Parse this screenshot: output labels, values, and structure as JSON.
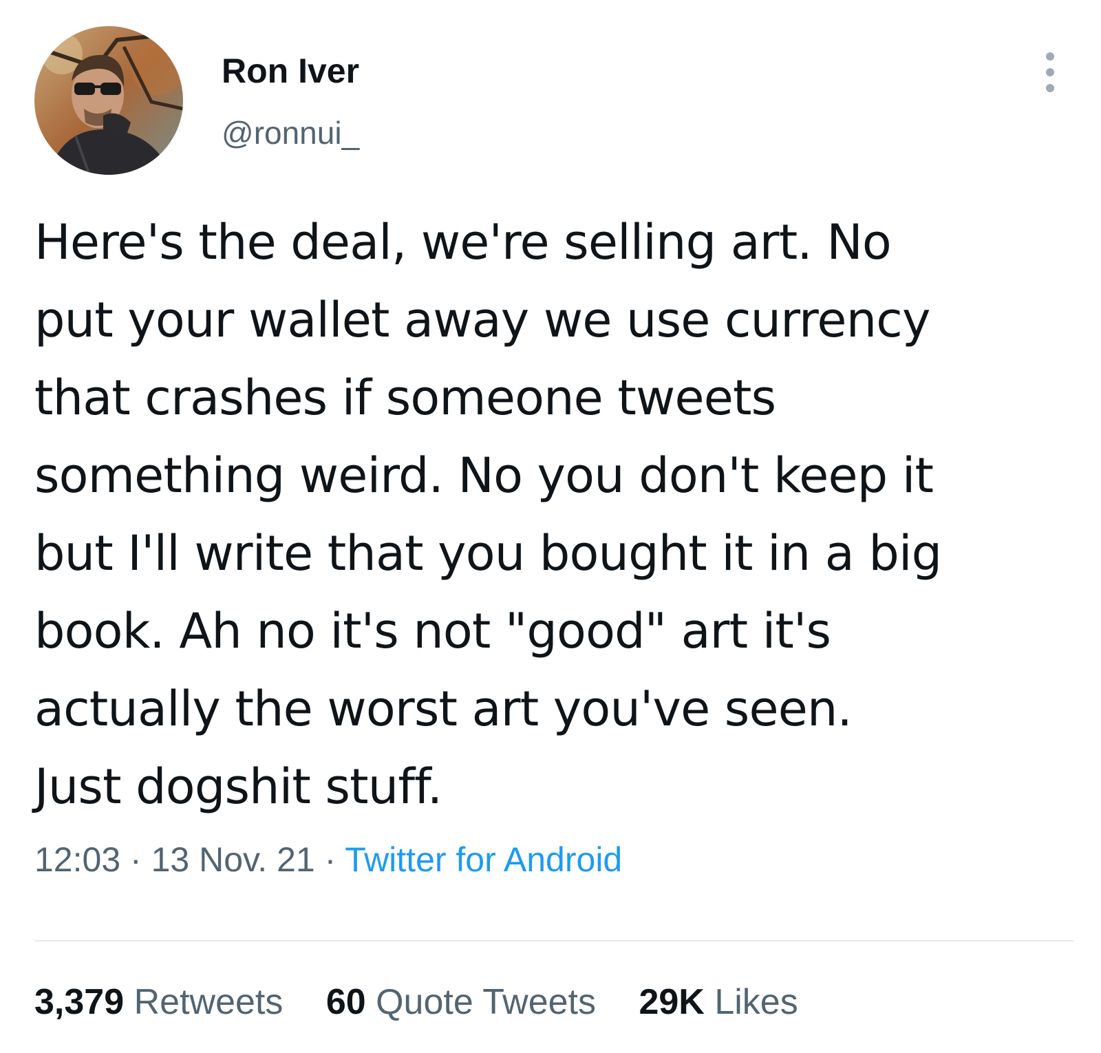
{
  "author": {
    "display_name": "Ron Iver",
    "handle": "@ronnui_"
  },
  "tweet": {
    "text": "Here's the deal, we're selling art. No\nput your wallet away we use currency\nthat crashes if someone tweets\nsomething weird. No you don't keep it\nbut I'll write that you bought it in a big\nbook. Ah no it's not \"good\" art it's\nactually the worst art you've seen.\nJust dogshit stuff.",
    "time": "12:03",
    "date": "13 Nov. 21",
    "separator": "·",
    "source": "Twitter for Android"
  },
  "stats": {
    "retweets_count": "3,379",
    "retweets_label": "Retweets",
    "quotes_count": "60",
    "quotes_label": "Quote Tweets",
    "likes_count": "29K",
    "likes_label": "Likes"
  },
  "icons": {
    "more": "more-vertical-icon"
  },
  "colors": {
    "text_primary": "#0f1419",
    "text_secondary": "#536471",
    "link": "#1d9bf0",
    "divider": "#e6e9ec"
  }
}
